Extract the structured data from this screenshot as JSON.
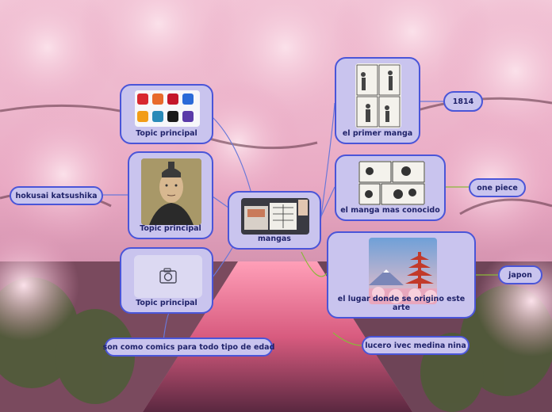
{
  "central": {
    "label": "mangas"
  },
  "topics": [
    {
      "id": "apps",
      "label": "Topic principal"
    },
    {
      "id": "portrait",
      "label": "Topic principal"
    },
    {
      "id": "camera",
      "label": "Topic principal"
    },
    {
      "id": "first",
      "label": "el primer manga"
    },
    {
      "id": "known",
      "label": "el manga mas conocido"
    },
    {
      "id": "origin",
      "label": "el lugar donde se origino este arte"
    }
  ],
  "subtopics": {
    "hokusai": "hokusai katsushika",
    "comics": "son como comics para todo tipo de edad",
    "year": "1814",
    "onepiece": "one piece",
    "japon": "japon",
    "author": "lucero ivec medina nina"
  },
  "colors": {
    "node_fill": "#c9c4ee",
    "node_border": "#4a55d8",
    "text": "#20236a",
    "link": "#6a78d8",
    "link_green": "#8ab83a"
  },
  "icons": {
    "camera": "camera-icon"
  }
}
